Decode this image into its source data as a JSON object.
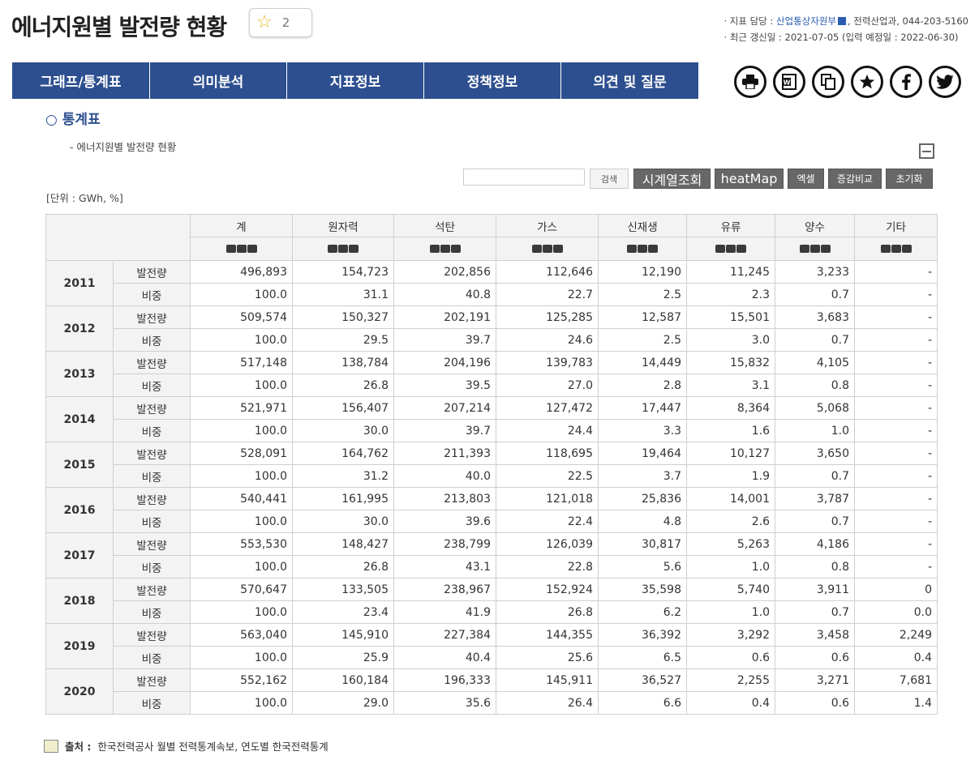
{
  "page": {
    "title": "에너지원별 발전량 현황",
    "favorite_count": "2"
  },
  "meta": {
    "line1_prefix": "· 지표 담당 : ",
    "line1_ministry": "산업통상자원부",
    "line1_dept": ", 전력산업과, 044-203-5160",
    "line2": "· 최근 갱신일 : 2021-07-05 (입력 예정일 : 2022-06-30)"
  },
  "tabs": [
    {
      "label": "그래프/통계표"
    },
    {
      "label": "의미분석"
    },
    {
      "label": "지표정보"
    },
    {
      "label": "정책정보"
    },
    {
      "label": "의견 및 질문"
    }
  ],
  "share_icons": [
    "print-icon",
    "word-icon",
    "copy-icon",
    "bookmark-star-icon",
    "facebook-icon",
    "twitter-icon"
  ],
  "section": {
    "title": "○ 통계표",
    "subtitle": "- 에너지원별 발전량 현황",
    "unit": "[단위 : GWh, %]"
  },
  "toolbar": {
    "search_label": "검색",
    "timeseries_label": "시계열조회",
    "heatmap_label": "heatMap",
    "excel_label": "엑셀",
    "compare_label": "증감비교",
    "reset_label": "초기화"
  },
  "table": {
    "columns": [
      "계",
      "원자력",
      "석탄",
      "가스",
      "신재생",
      "유류",
      "양수",
      "기타"
    ],
    "row_labels": {
      "gen": "발전량",
      "share": "비중"
    },
    "years": [
      {
        "year": "2011",
        "gen": [
          "496,893",
          "154,723",
          "202,856",
          "112,646",
          "12,190",
          "11,245",
          "3,233",
          "-"
        ],
        "share": [
          "100.0",
          "31.1",
          "40.8",
          "22.7",
          "2.5",
          "2.3",
          "0.7",
          "-"
        ]
      },
      {
        "year": "2012",
        "gen": [
          "509,574",
          "150,327",
          "202,191",
          "125,285",
          "12,587",
          "15,501",
          "3,683",
          "-"
        ],
        "share": [
          "100.0",
          "29.5",
          "39.7",
          "24.6",
          "2.5",
          "3.0",
          "0.7",
          "-"
        ]
      },
      {
        "year": "2013",
        "gen": [
          "517,148",
          "138,784",
          "204,196",
          "139,783",
          "14,449",
          "15,832",
          "4,105",
          "-"
        ],
        "share": [
          "100.0",
          "26.8",
          "39.5",
          "27.0",
          "2.8",
          "3.1",
          "0.8",
          "-"
        ]
      },
      {
        "year": "2014",
        "gen": [
          "521,971",
          "156,407",
          "207,214",
          "127,472",
          "17,447",
          "8,364",
          "5,068",
          "-"
        ],
        "share": [
          "100.0",
          "30.0",
          "39.7",
          "24.4",
          "3.3",
          "1.6",
          "1.0",
          "-"
        ]
      },
      {
        "year": "2015",
        "gen": [
          "528,091",
          "164,762",
          "211,393",
          "118,695",
          "19,464",
          "10,127",
          "3,650",
          "-"
        ],
        "share": [
          "100.0",
          "31.2",
          "40.0",
          "22.5",
          "3.7",
          "1.9",
          "0.7",
          "-"
        ]
      },
      {
        "year": "2016",
        "gen": [
          "540,441",
          "161,995",
          "213,803",
          "121,018",
          "25,836",
          "14,001",
          "3,787",
          "-"
        ],
        "share": [
          "100.0",
          "30.0",
          "39.6",
          "22.4",
          "4.8",
          "2.6",
          "0.7",
          "-"
        ]
      },
      {
        "year": "2017",
        "gen": [
          "553,530",
          "148,427",
          "238,799",
          "126,039",
          "30,817",
          "5,263",
          "4,186",
          "-"
        ],
        "share": [
          "100.0",
          "26.8",
          "43.1",
          "22.8",
          "5.6",
          "1.0",
          "0.8",
          "-"
        ]
      },
      {
        "year": "2018",
        "gen": [
          "570,647",
          "133,505",
          "238,967",
          "152,924",
          "35,598",
          "5,740",
          "3,911",
          "0"
        ],
        "share": [
          "100.0",
          "23.4",
          "41.9",
          "26.8",
          "6.2",
          "1.0",
          "0.7",
          "0.0"
        ]
      },
      {
        "year": "2019",
        "gen": [
          "563,040",
          "145,910",
          "227,384",
          "144,355",
          "36,392",
          "3,292",
          "3,458",
          "2,249"
        ],
        "share": [
          "100.0",
          "25.9",
          "40.4",
          "25.6",
          "6.5",
          "0.6",
          "0.6",
          "0.4"
        ]
      },
      {
        "year": "2020",
        "gen": [
          "552,162",
          "160,184",
          "196,333",
          "145,911",
          "36,527",
          "2,255",
          "3,271",
          "7,681"
        ],
        "share": [
          "100.0",
          "29.0",
          "35.6",
          "26.4",
          "6.6",
          "0.4",
          "0.6",
          "1.4"
        ]
      }
    ]
  },
  "source": {
    "label": "출처 :",
    "text": "한국전력공사 월별 전력통계속보, 연도별 한국전력통계"
  }
}
